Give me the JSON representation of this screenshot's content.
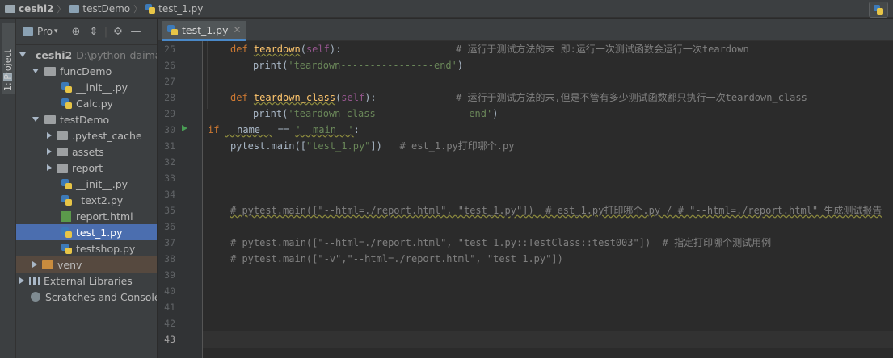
{
  "breadcrumb": {
    "project": "ceshi2",
    "folder": "testDemo",
    "file": "test_1.py"
  },
  "sidestrip": {
    "label": "1: Project"
  },
  "project_panel": {
    "view_label": "Pro",
    "items": [
      {
        "label": "ceshi2",
        "hint": "D:\\python-daima"
      },
      {
        "label": "funcDemo"
      },
      {
        "label": "__init__.py"
      },
      {
        "label": "Calc.py"
      },
      {
        "label": "testDemo"
      },
      {
        "label": ".pytest_cache"
      },
      {
        "label": "assets"
      },
      {
        "label": "report"
      },
      {
        "label": "__init__.py"
      },
      {
        "label": "_text2.py"
      },
      {
        "label": "report.html"
      },
      {
        "label": "test_1.py"
      },
      {
        "label": "testshop.py"
      },
      {
        "label": "venv"
      },
      {
        "label": "External Libraries"
      },
      {
        "label": "Scratches and Consoles"
      }
    ]
  },
  "editor": {
    "tab_label": "test_1.py",
    "line_numbers": [
      "25",
      "26",
      "27",
      "28",
      "29",
      "30",
      "31",
      "32",
      "33",
      "34",
      "35",
      "36",
      "37",
      "38",
      "39",
      "40",
      "41",
      "42",
      "43"
    ],
    "code": {
      "l25_def": "def ",
      "l25_name": "teardown",
      "l25_p1": "(",
      "l25_self": "self",
      "l25_p2": "):",
      "l25_comment": "# 运行于测试方法的末 即:运行一次测试函数会运行一次teardown",
      "l26_a": "print(",
      "l26_str": "'teardown----------------end'",
      "l26_b": ")",
      "l28_def": "def ",
      "l28_name": "teardown_class",
      "l28_p1": "(",
      "l28_self": "self",
      "l28_p2": "):",
      "l28_comment": "# 运行于测试方法的末,但是不管有多少测试函数都只执行一次teardown_class",
      "l29_a": "print(",
      "l29_str": "'teardown_class----------------end'",
      "l29_b": ")",
      "l30_if": "if ",
      "l30_name": "__name__",
      "l30_eq": " == ",
      "l30_str": "'__main__'",
      "l30_colon": ":",
      "l31_a": "pytest.main([",
      "l31_str": "\"test_1.py\"",
      "l31_b": "])   ",
      "l31_comment": "# est_1.py打印哪个.py",
      "l35": "# pytest.main([\"--html=./report.html\", \"test_1.py\"])  # est_1.py打印哪个.py / # \"--html=./report.html\" 生成测试报告",
      "l37": "# pytest.main([\"--html=./report.html\", \"test_1.py::TestClass::test003\"])  # 指定打印哪个测试用例",
      "l38": "# pytest.main([\"-v\",\"--html=./report.html\", \"test_1.py\"])"
    }
  },
  "colors": {
    "keyword": "#cc7832",
    "function": "#ffc66d",
    "string": "#6a8759",
    "comment": "#808080",
    "selection": "#4b6eaf"
  }
}
